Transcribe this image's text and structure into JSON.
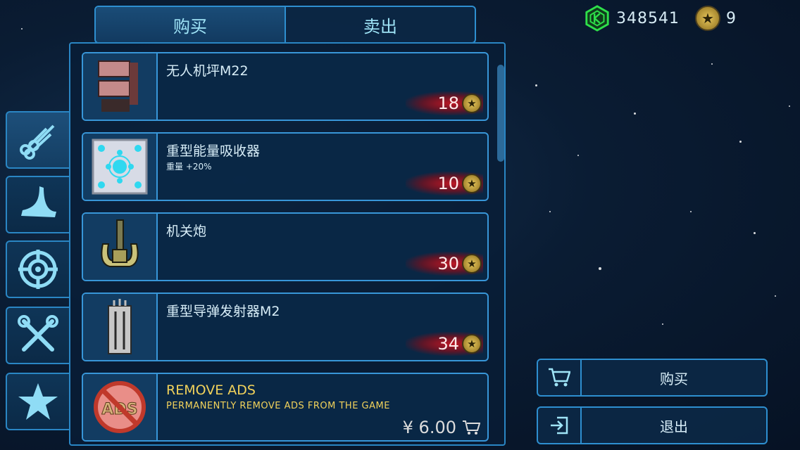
{
  "tabs": [
    {
      "label": "购买"
    },
    {
      "label": "卖出"
    }
  ],
  "currency": {
    "gems": "348541",
    "stars": "9",
    "gem_icon": "green-gem-icon",
    "star_icon": "star-coin-icon"
  },
  "sidebar": [
    {
      "icon": "pipes-icon"
    },
    {
      "icon": "wing-icon"
    },
    {
      "icon": "crosshair-icon"
    },
    {
      "icon": "tools-icon"
    },
    {
      "icon": "star-icon"
    }
  ],
  "items": [
    {
      "name": "无人机坪M22",
      "sub": "",
      "price": "18",
      "icon": "drone-pad-icon"
    },
    {
      "name": "重型能量吸收器",
      "sub": "重量 +20%",
      "price": "10",
      "icon": "energy-absorber-icon"
    },
    {
      "name": "机关炮",
      "sub": "",
      "price": "30",
      "icon": "autocannon-icon"
    },
    {
      "name": "重型导弹发射器M2",
      "sub": "",
      "price": "34",
      "icon": "missile-launcher-icon"
    }
  ],
  "remove_ads": {
    "title": "REMOVE ADS",
    "subtitle": "PERMANENTLY REMOVE ADS FROM THE GAME",
    "price": "¥ 6.00",
    "badge": "ADS"
  },
  "actions": {
    "buy_label": "购买",
    "exit_label": "退出"
  },
  "colors": {
    "accent": "#2e8fd0",
    "price_glow": "#d41421",
    "ad_text": "#f2d25b"
  }
}
